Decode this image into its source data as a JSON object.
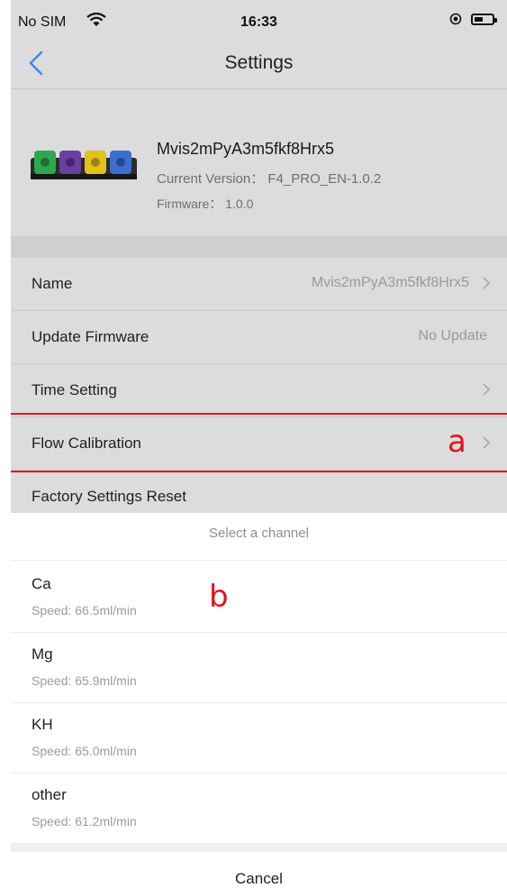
{
  "status_bar": {
    "carrier": "No SIM",
    "time": "16:33"
  },
  "header": {
    "title": "Settings"
  },
  "device": {
    "name": "Mvis2mPyA3m5fkf8Hrx5",
    "version": "Current Version： F4_PRO_EN-1.0.2",
    "firmware": "Firmware： 1.0.0"
  },
  "settings": [
    {
      "label": "Name",
      "value": "Mvis2mPyA3m5fkf8Hrx5"
    },
    {
      "label": "Update Firmware",
      "value": "No Update"
    },
    {
      "label": "Time Setting",
      "value": ""
    },
    {
      "label": "Flow Calibration",
      "value": ""
    },
    {
      "label": "Factory Settings Reset",
      "value": ""
    }
  ],
  "annotations": {
    "a": "a",
    "b": "b"
  },
  "sheet": {
    "title": "Select a channel",
    "options": [
      {
        "name": "Ca",
        "speed": "Speed: 66.5ml/min"
      },
      {
        "name": "Mg",
        "speed": "Speed: 65.9ml/min"
      },
      {
        "name": "KH",
        "speed": "Speed: 65.0ml/min"
      },
      {
        "name": "other",
        "speed": "Speed: 61.2ml/min"
      }
    ],
    "cancel": "Cancel"
  },
  "colors": {
    "highlight": "#e8121b",
    "accent": "#2f8df5",
    "dim": "#dcdcdc"
  },
  "icons": [
    "wifi-icon",
    "location-icon",
    "battery-icon",
    "back-icon",
    "chevron-right-icon",
    "device-image"
  ]
}
